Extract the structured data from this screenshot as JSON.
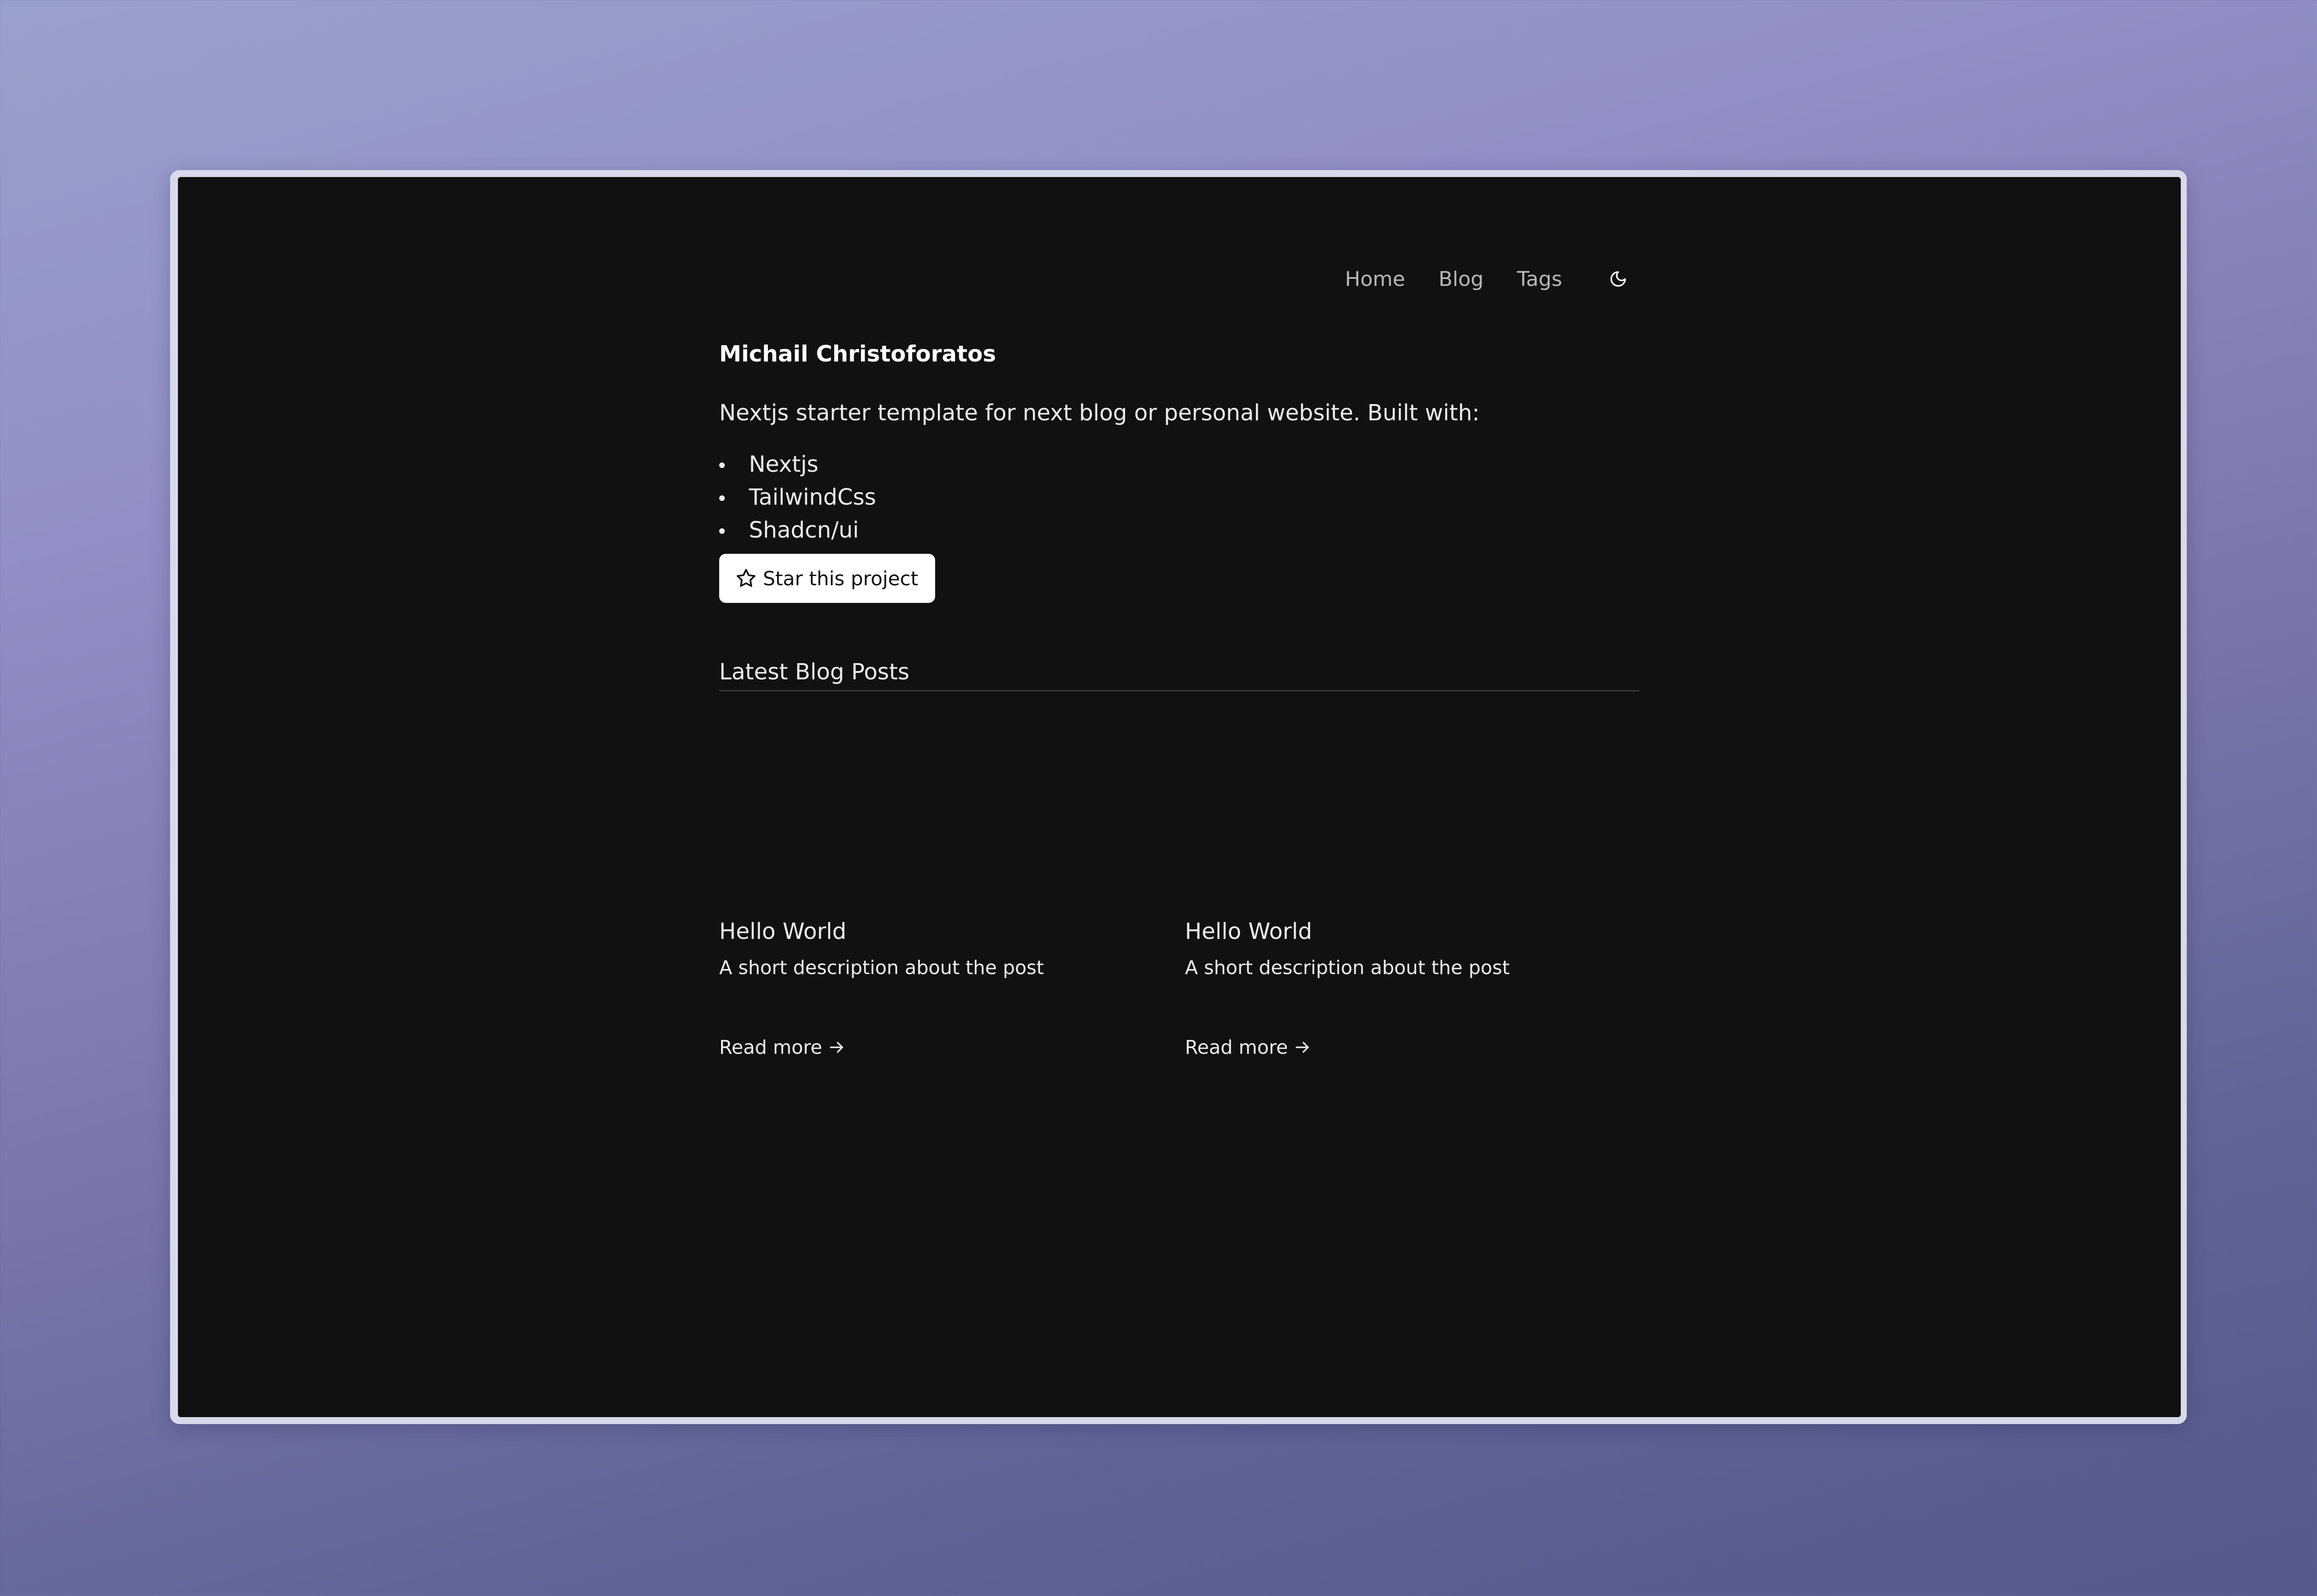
{
  "nav": {
    "items": [
      {
        "label": "Home"
      },
      {
        "label": "Blog"
      },
      {
        "label": "Tags"
      }
    ],
    "theme_icon": "moon-icon"
  },
  "hero": {
    "author": "Michail Christoforatos",
    "intro": "Nextjs starter template for next blog or personal website. Built with:",
    "stack": [
      "Nextjs",
      "TailwindCss",
      "Shadcn/ui"
    ],
    "star_button": {
      "label": "Star this project",
      "icon": "star-icon"
    }
  },
  "latest": {
    "title": "Latest Blog Posts",
    "posts": [
      {
        "title": "Hello World",
        "description": "A short description about the post",
        "link": "Read more"
      },
      {
        "title": "Hello World",
        "description": "A short description about the post",
        "link": "Read more"
      }
    ]
  },
  "colors": {
    "screen_bg": "#111111",
    "text": "#ededed",
    "nav_text": "#b8b8b8",
    "button_bg": "#ffffff",
    "divider": "#3a3a3a"
  }
}
